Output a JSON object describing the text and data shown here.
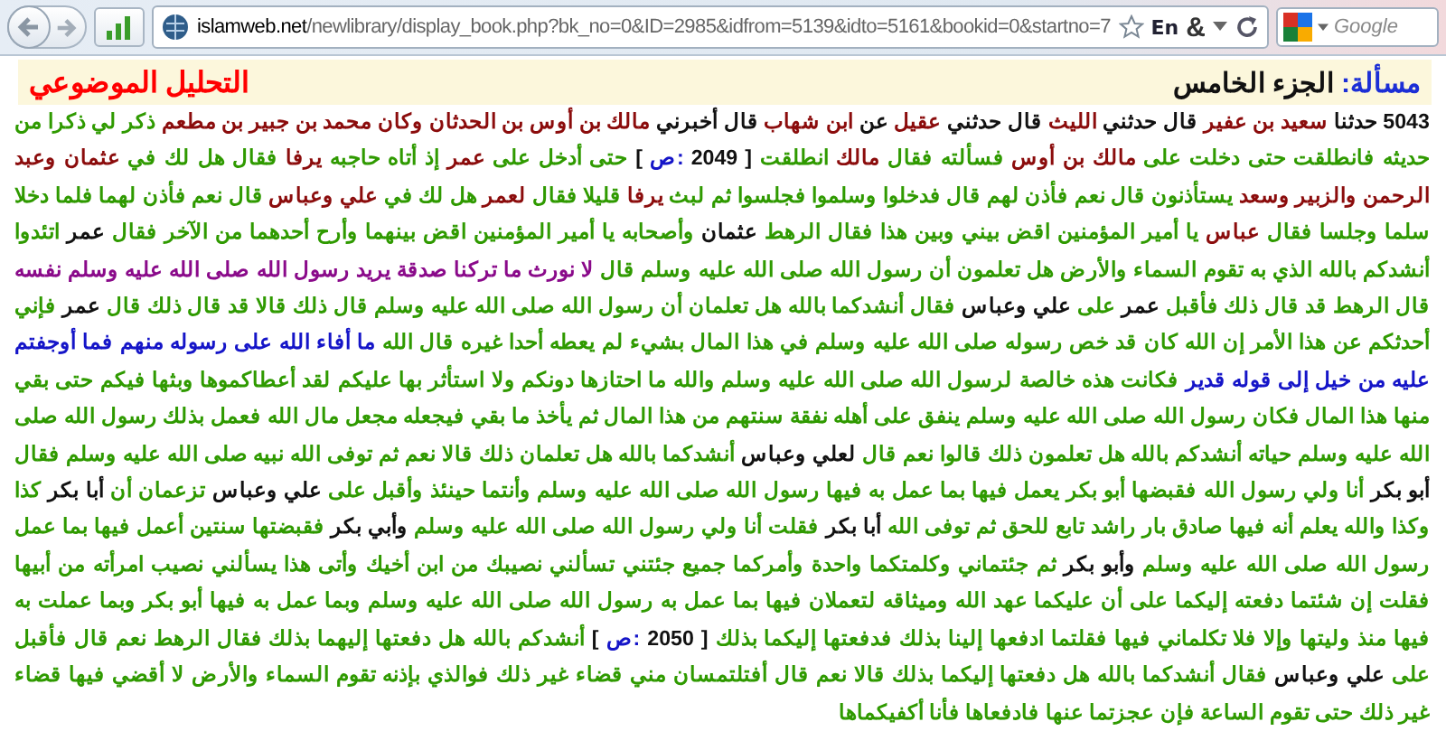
{
  "browser": {
    "url_host": "islamweb.net",
    "url_path": "/newlibrary/display_book.php?bk_no=0&ID=2985&idfrom=5139&idto=5161&bookid=0&startno=7",
    "language_badge": "En",
    "addon_symbol": "&",
    "search": {
      "placeholder": "Google"
    }
  },
  "header": {
    "label": "مسألة:",
    "volume": "الجزء الخامس",
    "topic_link": "التحليل الموضوعي"
  },
  "article": {
    "segments": [
      {
        "kind": "number",
        "text": "5043"
      },
      {
        "kind": "name",
        "text": "حدثنا"
      },
      {
        "kind": "narrator",
        "text": "سعيد بن عفير"
      },
      {
        "kind": "name",
        "text": "قال حدثني"
      },
      {
        "kind": "narrator",
        "text": "الليث"
      },
      {
        "kind": "name",
        "text": "قال حدثني"
      },
      {
        "kind": "narrator",
        "text": "عقيل"
      },
      {
        "kind": "name",
        "text": "عن"
      },
      {
        "kind": "narrator",
        "text": "ابن شهاب"
      },
      {
        "kind": "name",
        "text": "قال أخبرني"
      },
      {
        "kind": "narrator",
        "text": "مالك بن أوس بن الحدثان وكان محمد بن جبير بن مطعم"
      },
      {
        "kind": "text",
        "text": "ذكر لي ذكرا من حديثه فانطلقت حتى دخلت على"
      },
      {
        "kind": "narrator",
        "text": "مالك بن أوس"
      },
      {
        "kind": "text",
        "text": "فسألته فقال"
      },
      {
        "kind": "narrator",
        "text": "مالك"
      },
      {
        "kind": "text",
        "text": "انطلقت"
      },
      {
        "kind": "page-ref",
        "open": "[",
        "label": "ص:",
        "number": "2049",
        "close": "]"
      },
      {
        "kind": "text",
        "text": "حتى أدخل على"
      },
      {
        "kind": "narrator",
        "text": "عمر"
      },
      {
        "kind": "text",
        "text": "إذ أتاه حاجبه"
      },
      {
        "kind": "narrator",
        "text": "يرفا"
      },
      {
        "kind": "text",
        "text": "فقال هل لك في"
      },
      {
        "kind": "narrator",
        "text": "عثمان وعبد الرحمن والزبير وسعد"
      },
      {
        "kind": "text",
        "text": "يستأذنون قال نعم فأذن لهم قال فدخلوا وسلموا فجلسوا ثم لبث"
      },
      {
        "kind": "narrator",
        "text": "يرفا"
      },
      {
        "kind": "text",
        "text": "قليلا فقال"
      },
      {
        "kind": "narrator",
        "text": "لعمر"
      },
      {
        "kind": "text",
        "text": "هل لك في"
      },
      {
        "kind": "narrator",
        "text": "علي وعباس"
      },
      {
        "kind": "text",
        "text": "قال نعم فأذن لهما فلما دخلا سلما وجلسا فقال"
      },
      {
        "kind": "narrator",
        "text": "عباس"
      },
      {
        "kind": "text",
        "text": "يا أمير المؤمنين اقض بيني وبين هذا فقال الرهط"
      },
      {
        "kind": "name",
        "text": "عثمان"
      },
      {
        "kind": "text",
        "text": "وأصحابه يا أمير المؤمنين اقض بينهما وأرح أحدهما من الآخر فقال"
      },
      {
        "kind": "name",
        "text": "عمر"
      },
      {
        "kind": "text",
        "text": "اتئدوا أنشدكم بالله الذي به تقوم السماء والأرض هل تعلمون أن رسول الله صلى الله عليه وسلم قال"
      },
      {
        "kind": "hadith",
        "text": "لا نورث ما تركنا صدقة يريد رسول الله صلى الله عليه وسلم نفسه"
      },
      {
        "kind": "text",
        "text": "قال الرهط قد قال ذلك فأقبل"
      },
      {
        "kind": "name",
        "text": "عمر"
      },
      {
        "kind": "text",
        "text": "على"
      },
      {
        "kind": "name",
        "text": "علي وعباس"
      },
      {
        "kind": "text",
        "text": "فقال أنشدكما بالله هل تعلمان أن رسول الله صلى الله عليه وسلم قال ذلك قالا قد قال ذلك قال"
      },
      {
        "kind": "name",
        "text": "عمر"
      },
      {
        "kind": "text",
        "text": "فإني أحدثكم عن هذا الأمر إن الله كان قد خص رسوله صلى الله عليه وسلم في هذا المال بشيء لم يعطه أحدا غيره قال الله"
      },
      {
        "kind": "quran",
        "text": "ما أفاء الله على رسوله منهم فما أوجفتم عليه من خيل إلى قوله قدير"
      },
      {
        "kind": "text",
        "text": "فكانت هذه خالصة لرسول الله صلى الله عليه وسلم والله ما احتازها دونكم ولا استأثر بها عليكم لقد أعطاكموها وبثها فيكم حتى بقي منها هذا المال فكان رسول الله صلى الله عليه وسلم ينفق على أهله نفقة سنتهم من هذا المال ثم يأخذ ما بقي فيجعله مجعل مال الله فعمل بذلك رسول الله صلى الله عليه وسلم حياته أنشدكم بالله هل تعلمون ذلك قالوا نعم قال"
      },
      {
        "kind": "name",
        "text": "لعلي وعباس"
      },
      {
        "kind": "text",
        "text": "أنشدكما بالله هل تعلمان ذلك قالا نعم ثم توفى الله نبيه صلى الله عليه وسلم فقال"
      },
      {
        "kind": "name",
        "text": "أبو بكر"
      },
      {
        "kind": "text",
        "text": "أنا ولي رسول الله فقبضها أبو بكر يعمل فيها بما عمل به فيها رسول الله صلى الله عليه وسلم وأنتما حينئذ وأقبل على"
      },
      {
        "kind": "name",
        "text": "علي وعباس"
      },
      {
        "kind": "text",
        "text": "تزعمان أن"
      },
      {
        "kind": "name",
        "text": "أبا بكر"
      },
      {
        "kind": "text",
        "text": "كذا وكذا والله يعلم أنه فيها صادق بار راشد تابع للحق ثم توفى الله"
      },
      {
        "kind": "name",
        "text": "أبا بكر"
      },
      {
        "kind": "text",
        "text": "فقلت أنا ولي رسول الله صلى الله عليه وسلم"
      },
      {
        "kind": "name",
        "text": "وأبي بكر"
      },
      {
        "kind": "text",
        "text": "فقبضتها سنتين أعمل فيها بما عمل رسول الله صلى الله عليه وسلم"
      },
      {
        "kind": "name",
        "text": "وأبو بكر"
      },
      {
        "kind": "text",
        "text": "ثم جئتماني وكلمتكما واحدة وأمركما جميع جئتني تسألني نصيبك من ابن أخيك وأتى هذا يسألني نصيب امرأته من أبيها فقلت إن شئتما دفعته إليكما على أن عليكما عهد الله وميثاقه لتعملان فيها بما عمل به رسول الله صلى الله عليه وسلم وبما عمل به فيها أبو بكر وبما عملت به فيها منذ وليتها وإلا فلا تكلماني فيها فقلتما ادفعها إلينا بذلك فدفعتها إليكما بذلك"
      },
      {
        "kind": "page-ref",
        "open": "[",
        "label": "ص:",
        "number": "2050",
        "close": "]"
      },
      {
        "kind": "text",
        "text": "أنشدكم بالله هل دفعتها إليهما بذلك فقال الرهط نعم قال فأقبل على"
      },
      {
        "kind": "name",
        "text": "علي وعباس"
      },
      {
        "kind": "text",
        "text": "فقال أنشدكما بالله هل دفعتها إليكما بذلك قالا نعم قال أفتلتمسان مني قضاء غير ذلك فوالذي بإذنه تقوم السماء والأرض لا أقضي فيها قضاء غير ذلك حتى تقوم الساعة فإن عجزتما عنها فادفعاها فأنا أكفيكماها"
      }
    ]
  }
}
